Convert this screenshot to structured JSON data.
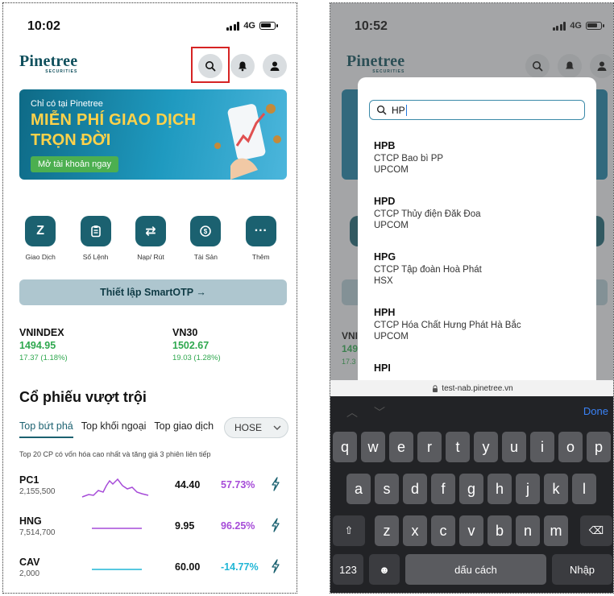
{
  "left": {
    "time": "10:02",
    "network": "4G",
    "logo": "Pinetree",
    "logo_sub": "SECURITIES",
    "banner": {
      "line1": "Chỉ có tại Pinetree",
      "line2": "MIỄN PHÍ GIAO DỊCH",
      "line3": "TRỌN ĐỜI",
      "cta": "Mở tài khoản ngay"
    },
    "actions": [
      {
        "label": "Giao Dịch",
        "icon": "z-icon"
      },
      {
        "label": "Sổ Lệnh",
        "icon": "clipboard-icon"
      },
      {
        "label": "Nạp/ Rút",
        "icon": "transfer-icon"
      },
      {
        "label": "Tài Sản",
        "icon": "asset-icon"
      },
      {
        "label": "Thêm",
        "icon": "more-icon"
      }
    ],
    "smartotp": "Thiết lập SmartOTP →",
    "indexes": [
      {
        "name": "VNINDEX",
        "value": "1494.95",
        "change": "17.37 (1.18%)"
      },
      {
        "name": "VN30",
        "value": "1502.67",
        "change": "19.03 (1.28%)"
      }
    ],
    "section_title": "Cổ phiếu vượt trội",
    "tabs": [
      "Top bứt phá",
      "Top khối ngoại",
      "Top giao dịch"
    ],
    "exchange": "HOSE",
    "subtitle": "Top 20 CP có vốn hóa cao nhất và tăng giá 3 phiên liên tiếp",
    "stocks": [
      {
        "symbol": "PC1",
        "volume": "2,155,500",
        "price": "44.40",
        "pct": "57.73%",
        "color": "#a64bd8",
        "spark": "purple"
      },
      {
        "symbol": "HNG",
        "volume": "7,514,700",
        "price": "9.95",
        "pct": "96.25%",
        "color": "#a64bd8",
        "spark": "flat-purple"
      },
      {
        "symbol": "CAV",
        "volume": "2,000",
        "price": "60.00",
        "pct": "-14.77%",
        "color": "#20b6d6",
        "spark": "flat-cyan"
      }
    ]
  },
  "right": {
    "time": "10:52",
    "network": "4G",
    "search_value": "HP",
    "results": [
      {
        "symbol": "HPB",
        "name": "CTCP Bao bì PP",
        "exchange": "UPCOM"
      },
      {
        "symbol": "HPD",
        "name": "CTCP Thủy điện Đăk Đoa",
        "exchange": "UPCOM"
      },
      {
        "symbol": "HPG",
        "name": "CTCP Tập đoàn Hoà Phát",
        "exchange": "HSX"
      },
      {
        "symbol": "HPH",
        "name": "CTCP Hóa Chất Hưng Phát Hà Bắc",
        "exchange": "UPCOM"
      },
      {
        "symbol": "HPI",
        "name": "",
        "exchange": ""
      }
    ],
    "url": "test-nab.pinetree.vn",
    "keyboard": {
      "done": "Done",
      "row1": [
        "q",
        "w",
        "e",
        "r",
        "t",
        "y",
        "u",
        "i",
        "o",
        "p"
      ],
      "row2": [
        "a",
        "s",
        "d",
        "f",
        "g",
        "h",
        "j",
        "k",
        "l"
      ],
      "row3": [
        "z",
        "x",
        "c",
        "v",
        "b",
        "n",
        "m"
      ],
      "numbers": "123",
      "space": "dấu cách",
      "enter": "Nhập"
    },
    "bg_index_partial": [
      "VNI",
      "149",
      "17.3"
    ]
  }
}
